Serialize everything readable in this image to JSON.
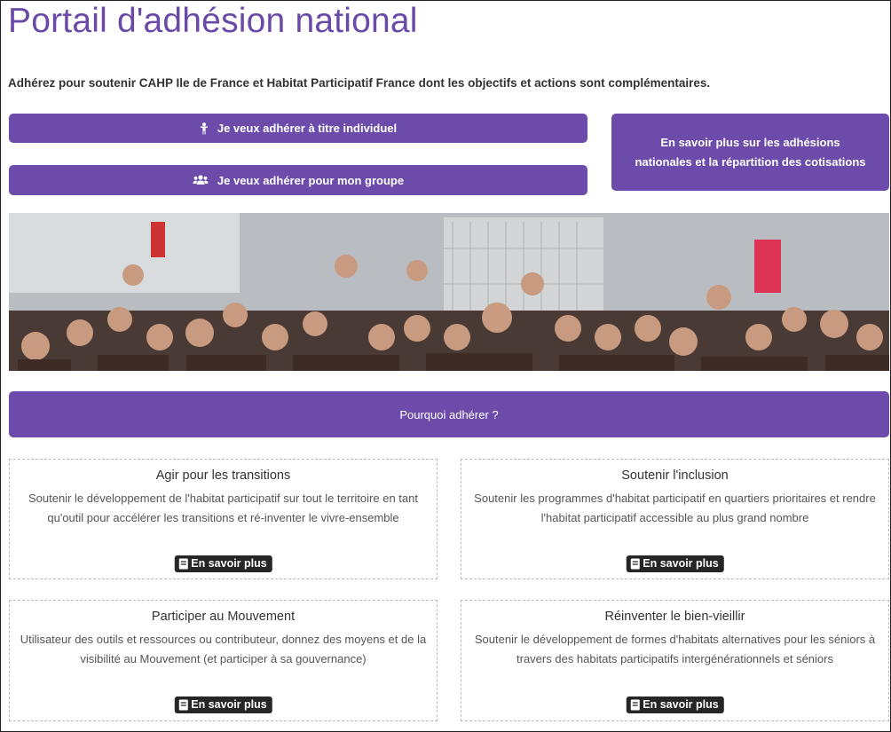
{
  "header": {
    "title": "Portail d'adhésion national",
    "intro": "Adhérez pour soutenir CAHP Ile de France et Habitat Participatif France dont les objectifs et actions sont complémentaires."
  },
  "actions": {
    "individual_label": "Je veux adhérer à titre individuel",
    "individual_icon": "person-icon",
    "group_label": "Je veux adhérer pour mon groupe",
    "group_icon": "group-icon",
    "info_label": "En savoir plus sur les adhésions nationales et la répartition des cotisations"
  },
  "why_button": {
    "label": "Pourquoi adhérer ?"
  },
  "cards": [
    {
      "title": "Agir pour les transitions",
      "text": "Soutenir le développement de l'habitat participatif sur tout le territoire en tant qu'outil pour accélérer les transitions et ré-inventer le vivre-ensemble",
      "more": "En savoir plus"
    },
    {
      "title": "Soutenir l'inclusion",
      "text": "Soutenir les programmes d'habitat participatif en quartiers prioritaires et rendre l'habitat participatif accessible au plus grand nombre",
      "more": "En savoir plus"
    },
    {
      "title": "Participer au Mouvement",
      "text": "Utilisateur des outils et ressources ou contributeur, donnez des moyens et de la visibilité au Mouvement (et participer à sa gouvernance)",
      "more": "En savoir plus"
    },
    {
      "title": "Réinventer le bien-vieillir",
      "text": "Soutenir le développement de formes d'habitats alternatives pour les séniors à travers des habitats participatifs intergénérationnels et séniors",
      "more": "En savoir plus"
    }
  ],
  "colors": {
    "accent": "#6c4bab",
    "title": "#6a4aa8",
    "more_button": "#262626"
  }
}
